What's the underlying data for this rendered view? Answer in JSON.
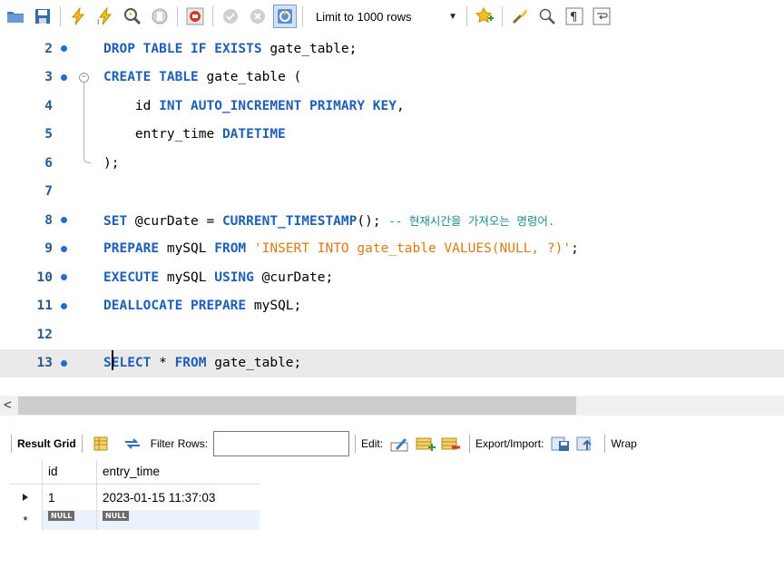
{
  "toolbar": {
    "limit_label": "Limit to 1000 rows",
    "icons": [
      "folder-icon",
      "save-icon",
      "execute-icon",
      "execute-current-icon",
      "explain-icon",
      "stop-icon",
      "toggle-error-icon",
      "commit-icon",
      "rollback-icon",
      "autocommit-icon",
      "add-snippet-icon",
      "beautify-icon",
      "find-icon",
      "invisible-chars-icon",
      "wrap-icon"
    ]
  },
  "editor": {
    "lines": [
      {
        "num": "2"
      },
      {
        "num": "3"
      },
      {
        "num": "4"
      },
      {
        "num": "5"
      },
      {
        "num": "6"
      },
      {
        "num": "7"
      },
      {
        "num": "8"
      },
      {
        "num": "9"
      },
      {
        "num": "10"
      },
      {
        "num": "11"
      },
      {
        "num": "12"
      },
      {
        "num": "13"
      }
    ],
    "tokens": {
      "l2_kw": "DROP TABLE IF EXISTS ",
      "l2_id": "gate_table;",
      "l3_kw": "CREATE TABLE ",
      "l3_id": "gate_table (",
      "l4_id1": "    id ",
      "l4_kw": "INT AUTO_INCREMENT PRIMARY KEY",
      "l4_id2": ",",
      "l5_id": "    entry_time ",
      "l5_kw": "DATETIME",
      "l6_id": ");",
      "l8_kw1": "SET ",
      "l8_id1": "@curDate = ",
      "l8_kw2": "CURRENT_TIMESTAMP",
      "l8_id2": "(); ",
      "l8_cmt": "-- 현재시간을 가져오는 명령어.",
      "l9_kw1": "PREPARE ",
      "l9_id1": "mySQL ",
      "l9_kw2": "FROM ",
      "l9_str": "'INSERT INTO gate_table VALUES(NULL, ?)'",
      "l9_id2": ";",
      "l10_kw1": "EXECUTE ",
      "l10_id1": "mySQL ",
      "l10_kw2": "USING ",
      "l10_id2": "@curDate;",
      "l11_kw": "DEALLOCATE PREPARE ",
      "l11_id": "mySQL;",
      "l13_kw1": "SELECT ",
      "l13_id1": "* ",
      "l13_kw2": "FROM ",
      "l13_id2": "gate_table;"
    }
  },
  "scrollbar": {
    "left_arrow": "<"
  },
  "result_toolbar": {
    "result_grid": "Result Grid",
    "filter_rows": "Filter Rows:",
    "filter_value": "",
    "edit": "Edit:",
    "export_import": "Export/Import:",
    "wrap": "Wrap"
  },
  "grid": {
    "columns": [
      "id",
      "entry_time"
    ],
    "rows": [
      {
        "id": "1",
        "entry_time": "2023-01-15 11:37:03"
      }
    ],
    "new_row": {
      "id": "NULL",
      "entry_time": "NULL"
    }
  },
  "colors": {
    "keyword": "#1f5fb5",
    "string": "#d97a14",
    "comment": "#1f8a8a",
    "breakpoint_dot": "#1f6fd1"
  }
}
